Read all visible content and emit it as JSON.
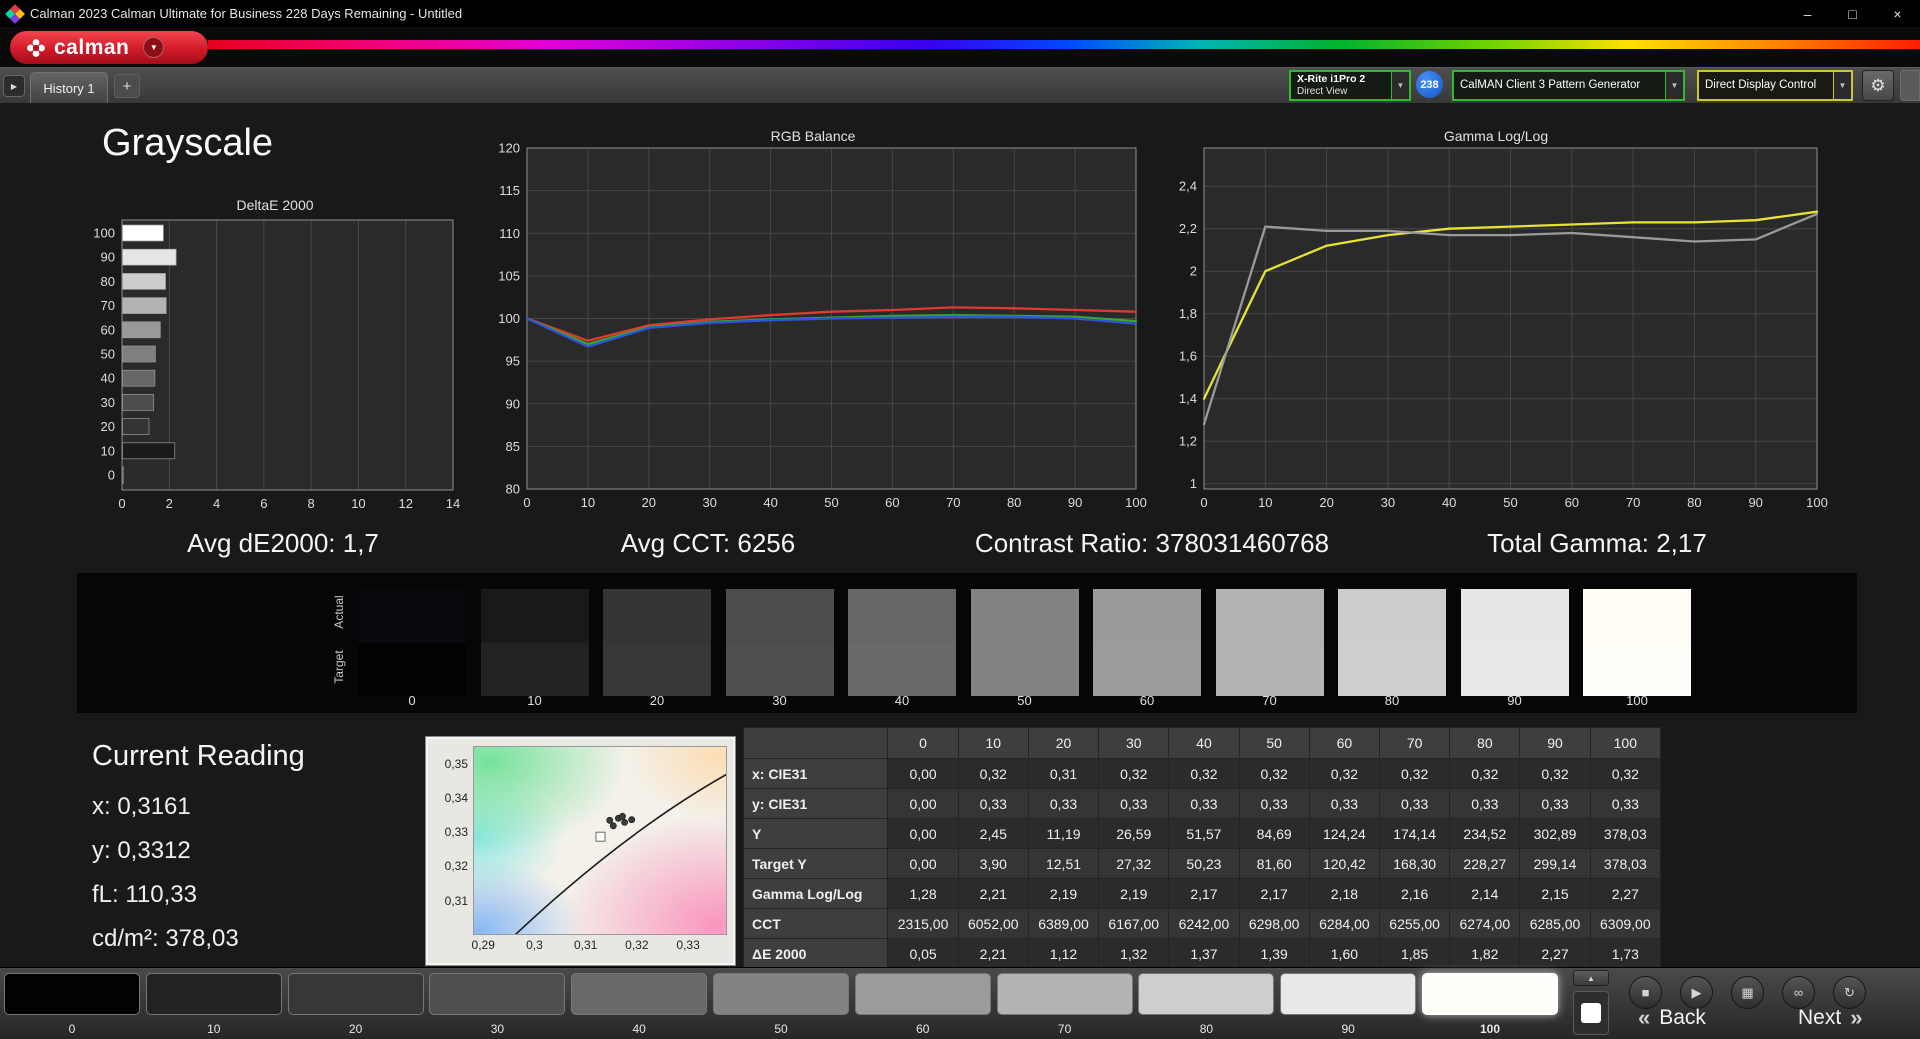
{
  "window": {
    "title": "Calman 2023 Calman Ultimate for Business 228 Days Remaining  - Untitled",
    "minimize": "–",
    "maximize": "□",
    "close": "×"
  },
  "icons": {
    "chevron_down": "▼",
    "plus": "+",
    "tab_scroll": "▶",
    "eject": "▲",
    "back_chevrons": "«",
    "next_chevrons": "»",
    "gear": "⚙"
  },
  "brand": {
    "logo_text": "calman"
  },
  "tabs": {
    "history_tab": "History 1"
  },
  "toolbar": {
    "meter_line1": "X-Rite i1Pro 2",
    "meter_line2": "Direct View",
    "badge": "238",
    "pattern_generator": "CalMAN Client 3 Pattern Generator",
    "display_control": "Direct Display Control"
  },
  "page": {
    "title": "Grayscale"
  },
  "stats": {
    "avg_de2000": "Avg dE2000: 1,7",
    "avg_cct": "Avg CCT: 6256",
    "contrast_ratio": "Contrast Ratio: 378031460768",
    "total_gamma": "Total Gamma: 2,17"
  },
  "swatch_strip": {
    "actual_label": "Actual",
    "target_label": "Target"
  },
  "grayscale_levels": [
    {
      "label": "0",
      "actual": "#08080c",
      "target": "#020204"
    },
    {
      "label": "10",
      "actual": "#191919",
      "target": "#222222"
    },
    {
      "label": "20",
      "actual": "#343434",
      "target": "#373737"
    },
    {
      "label": "30",
      "actual": "#4c4c4c",
      "target": "#4f4f4f"
    },
    {
      "label": "40",
      "actual": "#676767",
      "target": "#696969"
    },
    {
      "label": "50",
      "actual": "#828282",
      "target": "#838383"
    },
    {
      "label": "60",
      "actual": "#9a9a9a",
      "target": "#9b9b9b"
    },
    {
      "label": "70",
      "actual": "#b3b3b3",
      "target": "#b4b4b4"
    },
    {
      "label": "80",
      "actual": "#cdcdcd",
      "target": "#cecece"
    },
    {
      "label": "90",
      "actual": "#e7e7e7",
      "target": "#e8e8e8"
    },
    {
      "label": "100",
      "actual": "#fffdf6",
      "target": "#fffef9"
    }
  ],
  "current_reading": {
    "title": "Current Reading",
    "x": "x: 0,3161",
    "y": "y: 0,3312",
    "fl": "fL: 110,33",
    "cdm2": "cd/m²: 378,03"
  },
  "table": {
    "columns": [
      "",
      "0",
      "10",
      "20",
      "30",
      "40",
      "50",
      "60",
      "70",
      "80",
      "90",
      "100"
    ],
    "rows": [
      {
        "label": "x: CIE31",
        "values": [
          "0,00",
          "0,32",
          "0,31",
          "0,32",
          "0,32",
          "0,32",
          "0,32",
          "0,32",
          "0,32",
          "0,32",
          "0,32"
        ]
      },
      {
        "label": "y: CIE31",
        "values": [
          "0,00",
          "0,33",
          "0,33",
          "0,33",
          "0,33",
          "0,33",
          "0,33",
          "0,33",
          "0,33",
          "0,33",
          "0,33"
        ]
      },
      {
        "label": "Y",
        "values": [
          "0,00",
          "2,45",
          "11,19",
          "26,59",
          "51,57",
          "84,69",
          "124,24",
          "174,14",
          "234,52",
          "302,89",
          "378,03"
        ]
      },
      {
        "label": "Target Y",
        "values": [
          "0,00",
          "3,90",
          "12,51",
          "27,32",
          "50,23",
          "81,60",
          "120,42",
          "168,30",
          "228,27",
          "299,14",
          "378,03"
        ]
      },
      {
        "label": "Gamma Log/Log",
        "values": [
          "1,28",
          "2,21",
          "2,19",
          "2,19",
          "2,17",
          "2,17",
          "2,18",
          "2,16",
          "2,14",
          "2,15",
          "2,27"
        ]
      },
      {
        "label": "CCT",
        "values": [
          "2315,00",
          "6052,00",
          "6389,00",
          "6167,00",
          "6242,00",
          "6298,00",
          "6284,00",
          "6255,00",
          "6274,00",
          "6285,00",
          "6309,00"
        ]
      },
      {
        "label": "ΔE 2000",
        "values": [
          "0,05",
          "2,21",
          "1,12",
          "1,32",
          "1,37",
          "1,39",
          "1,60",
          "1,85",
          "1,82",
          "2,27",
          "1,73"
        ]
      }
    ]
  },
  "bottom": {
    "selected": "100",
    "back_label": "Back",
    "next_label": "Next"
  },
  "transport_icons": [
    {
      "name": "stop-icon",
      "glyph": "■"
    },
    {
      "name": "play-icon",
      "glyph": "▶"
    },
    {
      "name": "save-icon",
      "glyph": "▦"
    },
    {
      "name": "link-icon",
      "glyph": "∞"
    },
    {
      "name": "refresh-icon",
      "glyph": "↻"
    }
  ],
  "chart_data": [
    {
      "id": "deltae",
      "type": "bar",
      "orientation": "horizontal",
      "title": "DeltaE 2000",
      "categories": [
        100,
        90,
        80,
        70,
        60,
        50,
        40,
        30,
        20,
        10,
        0
      ],
      "values": [
        1.73,
        2.27,
        1.82,
        1.85,
        1.6,
        1.39,
        1.37,
        1.32,
        1.12,
        2.21,
        0.05
      ],
      "xlim": [
        0,
        14
      ],
      "xticks": [
        0,
        2,
        4,
        6,
        8,
        10,
        12,
        14
      ],
      "bar_shading": "each bar filled with the gray tone of its stimulus level"
    },
    {
      "id": "rgb-balance",
      "type": "line",
      "title": "RGB Balance",
      "x": [
        0,
        10,
        20,
        30,
        40,
        50,
        60,
        70,
        80,
        90,
        100
      ],
      "ylim": [
        80,
        120
      ],
      "yticks": [
        120,
        115,
        110,
        105,
        100,
        95,
        90,
        85,
        80
      ],
      "grid": true,
      "series": [
        {
          "name": "Red",
          "color": "#e03a2f",
          "values": [
            100,
            97.4,
            99.2,
            99.9,
            100.4,
            100.8,
            101.0,
            101.3,
            101.2,
            101.0,
            100.8
          ]
        },
        {
          "name": "Green",
          "color": "#35a82f",
          "values": [
            100,
            97.0,
            99.0,
            99.6,
            99.9,
            100.1,
            100.3,
            100.4,
            100.3,
            100.2,
            99.7
          ]
        },
        {
          "name": "Blue",
          "color": "#2f55d8",
          "values": [
            100,
            96.7,
            98.9,
            99.5,
            99.8,
            100.0,
            100.1,
            100.2,
            100.2,
            100.0,
            99.4
          ]
        }
      ]
    },
    {
      "id": "gamma",
      "type": "line",
      "title": "Gamma Log/Log",
      "x": [
        0,
        10,
        20,
        30,
        40,
        50,
        60,
        70,
        80,
        90,
        100
      ],
      "ylim": [
        0.975,
        2.58
      ],
      "yticks": [
        2.4,
        2.2,
        2.0,
        1.8,
        1.6,
        1.4,
        1.2,
        1.0
      ],
      "ytick_labels": [
        "2,4",
        "2,2",
        "2",
        "1,8",
        "1,6",
        "1,4",
        "1,2",
        "1"
      ],
      "grid": true,
      "series": [
        {
          "name": "Gamma smooth",
          "color": "#e8e332",
          "values": [
            1.4,
            2.0,
            2.12,
            2.17,
            2.2,
            2.21,
            2.22,
            2.23,
            2.23,
            2.24,
            2.28
          ]
        },
        {
          "name": "Gamma measured",
          "color": "#9a9a9a",
          "values": [
            1.28,
            2.21,
            2.19,
            2.19,
            2.17,
            2.17,
            2.18,
            2.16,
            2.14,
            2.15,
            2.27
          ]
        }
      ]
    },
    {
      "id": "cie",
      "type": "scatter",
      "title": "CIE 1931 xy",
      "xlim": [
        0.288,
        0.3376
      ],
      "ylim": [
        0.2999,
        0.3553
      ],
      "xticks": [
        {
          "v": 0.29,
          "label": "0,29"
        },
        {
          "v": 0.3,
          "label": "0,3"
        },
        {
          "v": 0.31,
          "label": "0,31"
        },
        {
          "v": 0.32,
          "label": "0,32"
        },
        {
          "v": 0.33,
          "label": "0,33"
        }
      ],
      "yticks": [
        {
          "v": 0.35,
          "label": "0,35"
        },
        {
          "v": 0.34,
          "label": "0,34"
        },
        {
          "v": 0.33,
          "label": "0,33"
        },
        {
          "v": 0.32,
          "label": "0,32"
        },
        {
          "v": 0.31,
          "label": "0,31"
        }
      ],
      "points": [
        {
          "x": 0.3145,
          "y": 0.3338
        },
        {
          "x": 0.3162,
          "y": 0.3344
        },
        {
          "x": 0.3174,
          "y": 0.3332
        },
        {
          "x": 0.3188,
          "y": 0.334
        },
        {
          "x": 0.3152,
          "y": 0.3322
        },
        {
          "x": 0.317,
          "y": 0.335
        }
      ],
      "reference_point": {
        "x": 0.3127,
        "y": 0.329
      },
      "locus": [
        {
          "x": 0.2955,
          "y": 0.2995
        },
        {
          "x": 0.317,
          "y": 0.327
        },
        {
          "x": 0.3376,
          "y": 0.3475
        }
      ]
    }
  ]
}
